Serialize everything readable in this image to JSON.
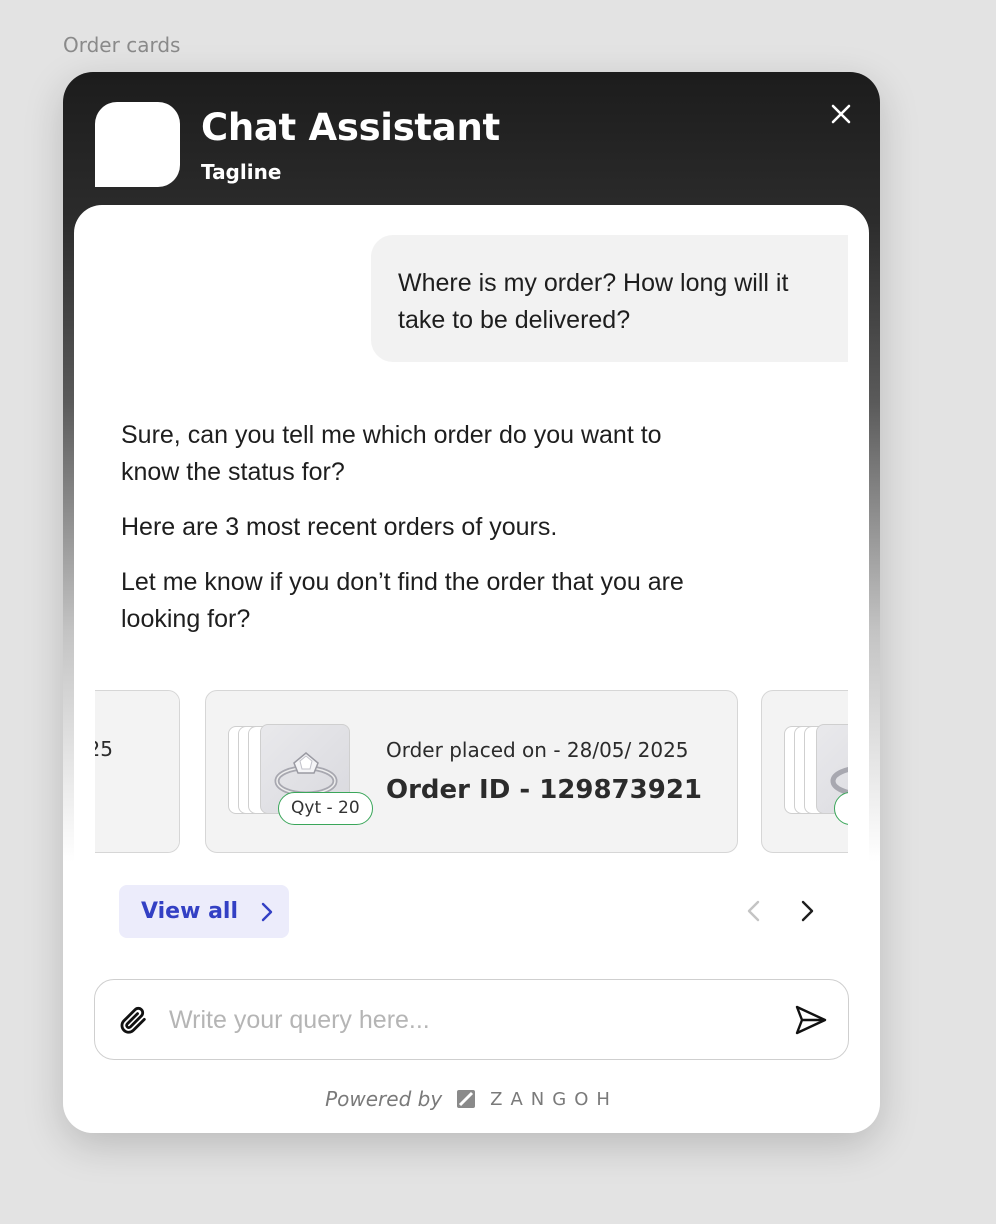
{
  "frame_label": "Order cards",
  "header": {
    "title": "Chat Assistant",
    "tagline": "Tagline"
  },
  "messages": {
    "user": "Where is my order? How long will it take to be delivered?",
    "bot": [
      "Sure, can you tell me which order do you want to know the status for?",
      "Here are 3 most recent orders of yours.",
      "Let me know if you don’t find the order that you are looking for?"
    ]
  },
  "order_cards": {
    "left_fragment": "25",
    "center": {
      "qty": "Qyt - 20",
      "date": "Order placed on - 28/05/ 2025",
      "order_id": "Order ID - 129873921"
    }
  },
  "actions": {
    "view_all": "View all"
  },
  "composer": {
    "placeholder": "Write your query here..."
  },
  "footer": {
    "powered_by": "Powered by",
    "brand": "ZANGOH"
  },
  "colors": {
    "accent": "#3340c4",
    "accent_bg": "#ececfb",
    "qty_border": "#3aa65a"
  }
}
